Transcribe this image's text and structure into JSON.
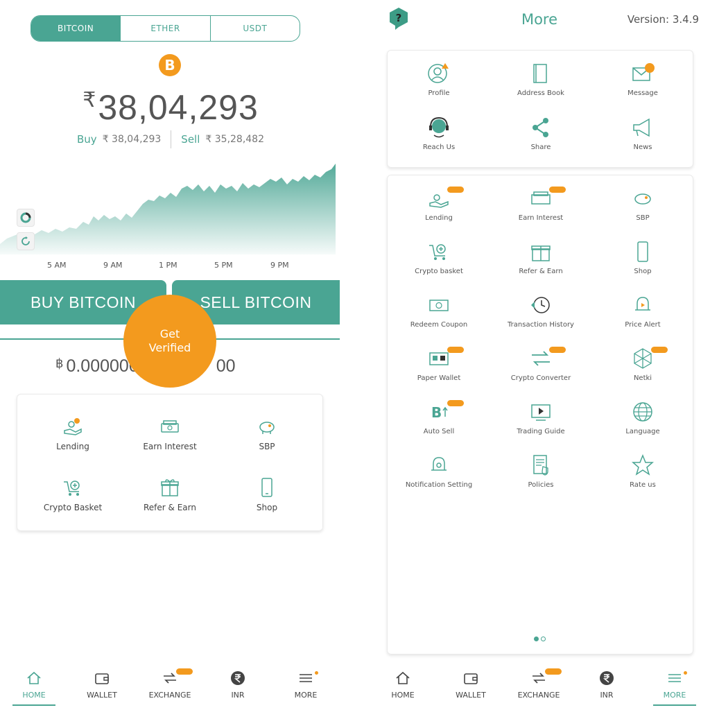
{
  "home": {
    "tabs": [
      "BITCOIN",
      "ETHER",
      "USDT"
    ],
    "active_tab": 0,
    "coin_logo": "B",
    "price_symbol": "₹",
    "price": "38,04,293",
    "buy_label": "Buy",
    "buy_price": "₹ 38,04,293",
    "sell_label": "Sell",
    "sell_price": "₹ 35,28,482",
    "time_labels": [
      "5 AM",
      "9 AM",
      "1 PM",
      "5 PM",
      "9 PM"
    ],
    "buy_button": "BUY BITCOIN",
    "sell_button": "SELL BITCOIN",
    "balance_symbol": "฿",
    "balance_visible_left": "0.000000",
    "balance_visible_right": "00",
    "verify_line1": "Get",
    "verify_line2": "Verified",
    "features": [
      {
        "label": "Lending",
        "icon": "lending-icon"
      },
      {
        "label": "Earn Interest",
        "icon": "earn-interest-icon"
      },
      {
        "label": "SBP",
        "icon": "piggy-bank-icon"
      },
      {
        "label": "Crypto Basket",
        "icon": "crypto-basket-icon"
      },
      {
        "label": "Refer & Earn",
        "icon": "gift-icon"
      },
      {
        "label": "Shop",
        "icon": "phone-icon"
      }
    ]
  },
  "nav": {
    "items": [
      "HOME",
      "WALLET",
      "EXCHANGE",
      "INR",
      "MORE"
    ]
  },
  "more": {
    "title": "More",
    "version": "Version: 3.4.9",
    "top_items": [
      {
        "label": "Profile",
        "icon": "profile-icon"
      },
      {
        "label": "Address Book",
        "icon": "address-book-icon"
      },
      {
        "label": "Message",
        "icon": "message-icon"
      },
      {
        "label": "Reach Us",
        "icon": "headset-icon"
      },
      {
        "label": "Share",
        "icon": "share-icon"
      },
      {
        "label": "News",
        "icon": "megaphone-icon"
      }
    ],
    "items": [
      {
        "label": "Lending",
        "icon": "lending-icon"
      },
      {
        "label": "Earn Interest",
        "icon": "earn-interest-icon"
      },
      {
        "label": "SBP",
        "icon": "piggy-bank-icon"
      },
      {
        "label": "Crypto basket",
        "icon": "crypto-basket-icon"
      },
      {
        "label": "Refer & Earn",
        "icon": "gift-icon"
      },
      {
        "label": "Shop",
        "icon": "phone-icon"
      },
      {
        "label": "Redeem Coupon",
        "icon": "coupon-icon"
      },
      {
        "label": "Transaction History",
        "icon": "history-icon"
      },
      {
        "label": "Price Alert",
        "icon": "bell-icon"
      },
      {
        "label": "Paper Wallet",
        "icon": "paper-wallet-icon"
      },
      {
        "label": "Crypto Converter",
        "icon": "converter-icon"
      },
      {
        "label": "Netki",
        "icon": "netki-icon"
      },
      {
        "label": "Auto Sell",
        "icon": "auto-sell-icon"
      },
      {
        "label": "Trading Guide",
        "icon": "video-icon"
      },
      {
        "label": "Language",
        "icon": "globe-icon"
      },
      {
        "label": "Notification Setting",
        "icon": "notification-setting-icon"
      },
      {
        "label": "Policies",
        "icon": "policies-icon"
      },
      {
        "label": "Rate us",
        "icon": "star-icon"
      }
    ]
  },
  "colors": {
    "accent": "#4aa593",
    "highlight": "#f39a1e"
  }
}
